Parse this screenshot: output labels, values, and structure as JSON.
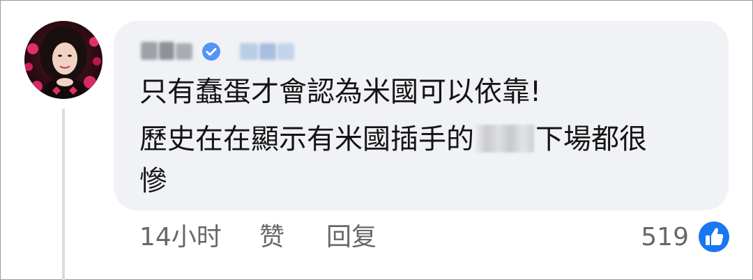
{
  "comment": {
    "lines": [
      "只有蠢蛋才會認為米國可以依靠!",
      "歷史在在顯示有米國插手的",
      "下場都很",
      "慘"
    ]
  },
  "actions": {
    "time": "14小时",
    "like": "赞",
    "reply": "回复"
  },
  "reactions": {
    "count": "519",
    "icon": "thumbs-up-icon"
  },
  "colors": {
    "bubble": "#f0f2f5",
    "meta_text": "#65676b",
    "verified_blue": "#1877f2",
    "like_blue": "#1877f2"
  }
}
